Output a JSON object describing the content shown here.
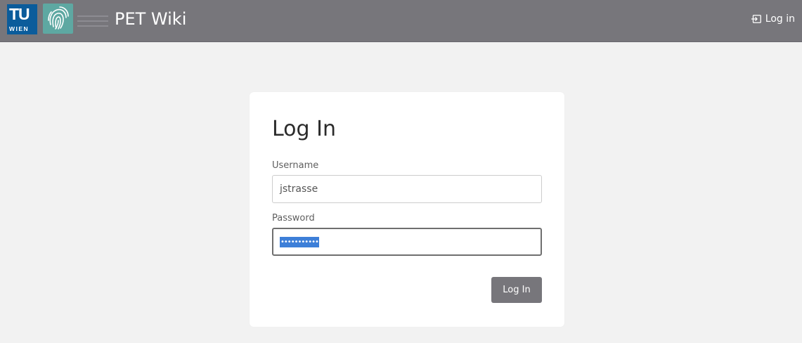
{
  "header": {
    "tu_logo_top": "TU",
    "tu_logo_bottom": "WIEN",
    "title": "PET Wiki",
    "login_label": "Log in",
    "icons": {
      "login": "login-icon",
      "fingerprint": "fingerprint-logo-icon"
    },
    "bg_color": "#77767b",
    "tu_color": "#0b5c9b",
    "finger_color": "#5ea8a2"
  },
  "login_form": {
    "heading": "Log In",
    "username_label": "Username",
    "username_value": "jstrasse",
    "password_label": "Password",
    "password_masked": "•••••••••••",
    "submit_label": "Log In"
  }
}
